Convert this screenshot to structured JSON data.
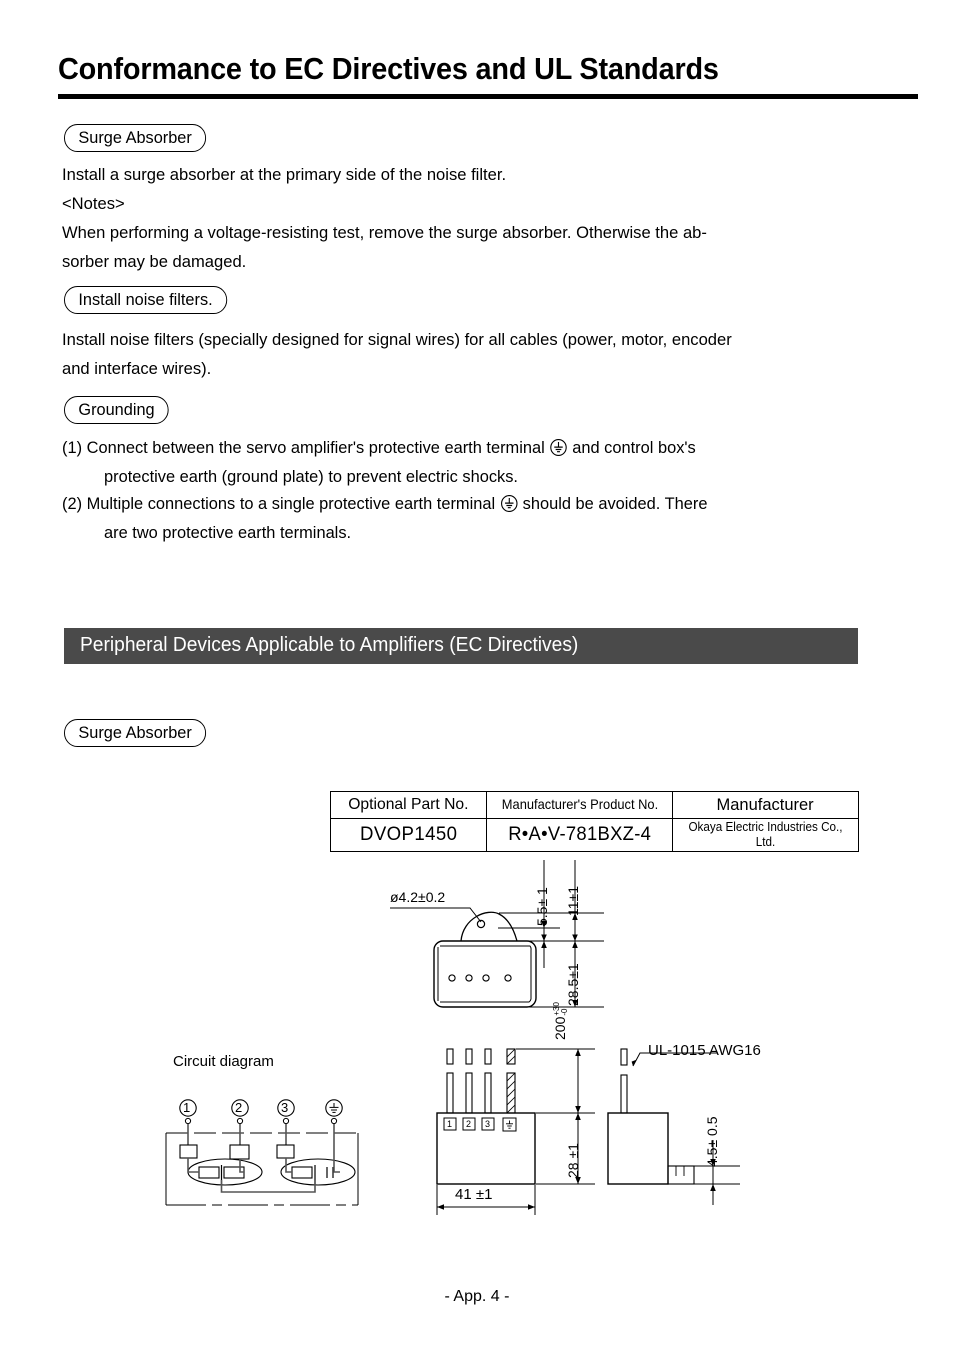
{
  "document": {
    "title": "Conformance to EC Directives and UL Standards",
    "footer": "- App. 4 -"
  },
  "sections": [
    {
      "heading": "Surge Absorber",
      "paragraphs": [
        "Install a surge absorber at the primary side of the noise filter.",
        "<Notes>",
        "When performing a voltage-resisting test, remove the surge absorber. Otherwise the ab-\nsorber may be damaged."
      ]
    },
    {
      "heading": "Install noise filters.",
      "paragraphs": [
        "Install noise filters (specially designed for signal wires) for all cables (power, motor, encoder\nand interface wires)."
      ]
    },
    {
      "heading": "Grounding",
      "items": [
        {
          "number": "(1)",
          "text_before": "Connect between the servo amplifier's protective earth terminal",
          "text_after": "and control box's",
          "continuation": "protective earth (ground plate) to prevent electric shocks."
        },
        {
          "number": "(2)",
          "text_before": "Multiple connections to a single protective earth terminal",
          "text_after": "should be avoided. There",
          "continuation": "are two protective earth terminals."
        }
      ]
    }
  ],
  "banner": {
    "label": "Peripheral Devices Applicable to Amplifiers (EC Directives)",
    "background_color": "#4a4a4a",
    "text_color": "#ffffff"
  },
  "subsection": {
    "heading": "Surge Absorber"
  },
  "table": {
    "headers": [
      "Optional Part No.",
      "Manufacturer's Product No.",
      "Manufacturer"
    ],
    "rows": [
      [
        "DVOP1450",
        "R•A•V-781BXZ-4",
        "Okaya Electric Industries Co., Ltd."
      ]
    ]
  },
  "drawings": {
    "top_view": {
      "hole_diameter": "ø4.2±0.2",
      "dim_5_5": "5.5± 1",
      "dim_11": "11±1",
      "dim_28_5": "28.5±1"
    },
    "front_view": {
      "width": "41 ±1",
      "body_height": "28 ±1",
      "lead_length_value": "200",
      "lead_length_tol_upper": "+30",
      "lead_length_tol_lower": "-0",
      "terminal_labels": [
        "1",
        "2",
        "3",
        "earth-symbol"
      ]
    },
    "side_view": {
      "wire_spec": "UL-1015 AWG16",
      "flange_thickness": "4.5± 0.5"
    },
    "circuit_diagram": {
      "title": "Circuit diagram",
      "terminals": [
        "①",
        "②",
        "③",
        "earth-symbol"
      ]
    }
  }
}
